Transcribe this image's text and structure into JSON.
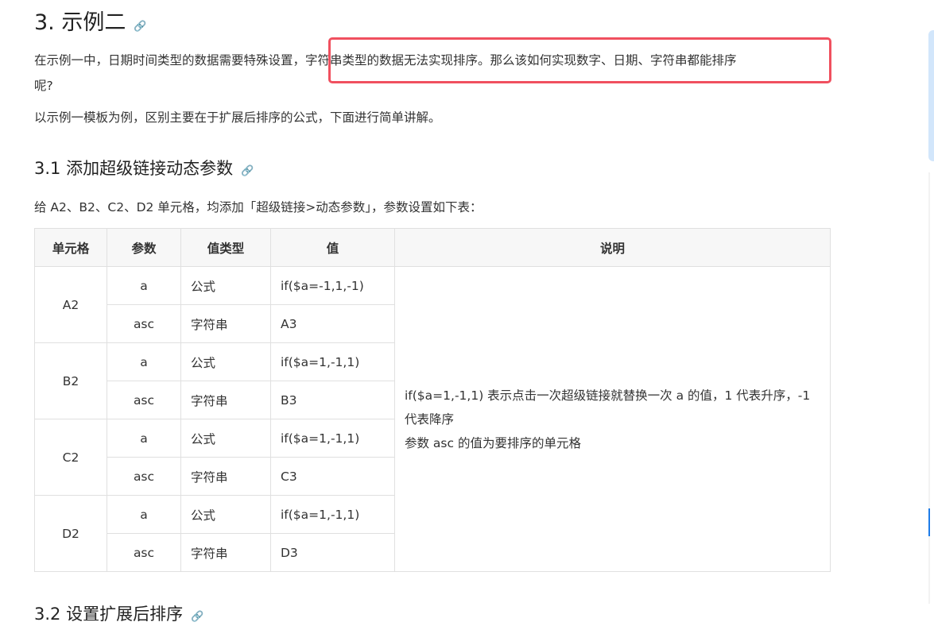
{
  "heading": "3. 示例二",
  "para1a": "在示例一中，日期时间类型的数据需要特殊设置，字符串类型的数据无法实现排序。那么该如何实现数字、日期、字符串都能排序",
  "para1b": "呢?",
  "para2": "以示例一模板为例，区别主要在于扩展后排序的公式，下面进行简单讲解。",
  "sub1": "3.1 添加超级链接动态参数",
  "para3": "给 A2、B2、C2、D2 单元格，均添加「超级链接>动态参数」，参数设置如下表：",
  "table": {
    "headers": [
      "单元格",
      "参数",
      "值类型",
      "值",
      "说明"
    ],
    "groups": [
      {
        "cell": "A2",
        "rows": [
          [
            "a",
            "公式",
            "if($a=-1,1,-1)"
          ],
          [
            "asc",
            "字符串",
            "A3"
          ]
        ]
      },
      {
        "cell": "B2",
        "rows": [
          [
            "a",
            "公式",
            "if($a=1,-1,1)"
          ],
          [
            "asc",
            "字符串",
            "B3"
          ]
        ]
      },
      {
        "cell": "C2",
        "rows": [
          [
            "a",
            "公式",
            "if($a=1,-1,1)"
          ],
          [
            "asc",
            "字符串",
            "C3"
          ]
        ]
      },
      {
        "cell": "D2",
        "rows": [
          [
            "a",
            "公式",
            "if($a=1,-1,1)"
          ],
          [
            "asc",
            "字符串",
            "D3"
          ]
        ]
      }
    ],
    "desc1": "if($a=1,-1,1) 表示点击一次超级链接就替换一次 a 的值，1 代表升序，-1 代表降序",
    "desc2": "参数 asc 的值为要排序的单元格"
  },
  "sub2": "3.2 设置扩展后排序",
  "link_icon": "🔗",
  "colors": {
    "highlight": "#f0505f",
    "toc_active": "#1e7ce8"
  }
}
